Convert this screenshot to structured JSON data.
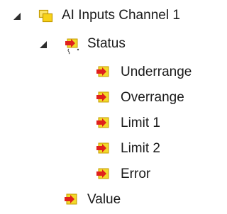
{
  "tree": {
    "root": {
      "label": "AI Inputs Channel 1",
      "icon": "folder-yellow-icon",
      "expanded": true
    },
    "status": {
      "label": "Status",
      "icon": "input-variable-icon",
      "expanded": true,
      "children": [
        {
          "label": "Underrange",
          "icon": "input-variable-icon"
        },
        {
          "label": "Overrange",
          "icon": "input-variable-icon"
        },
        {
          "label": "Limit 1",
          "icon": "input-variable-icon"
        },
        {
          "label": "Limit 2",
          "icon": "input-variable-icon"
        },
        {
          "label": "Error",
          "icon": "input-variable-icon"
        }
      ]
    },
    "value": {
      "label": "Value",
      "icon": "input-variable-icon"
    }
  },
  "colors": {
    "folder_fill": "#f7d21a",
    "folder_stroke": "#c49b00",
    "var_fill": "#f2d92a",
    "var_arrow": "#e0201c",
    "expander": "#2d2d2d",
    "text": "#1a1a1a"
  }
}
